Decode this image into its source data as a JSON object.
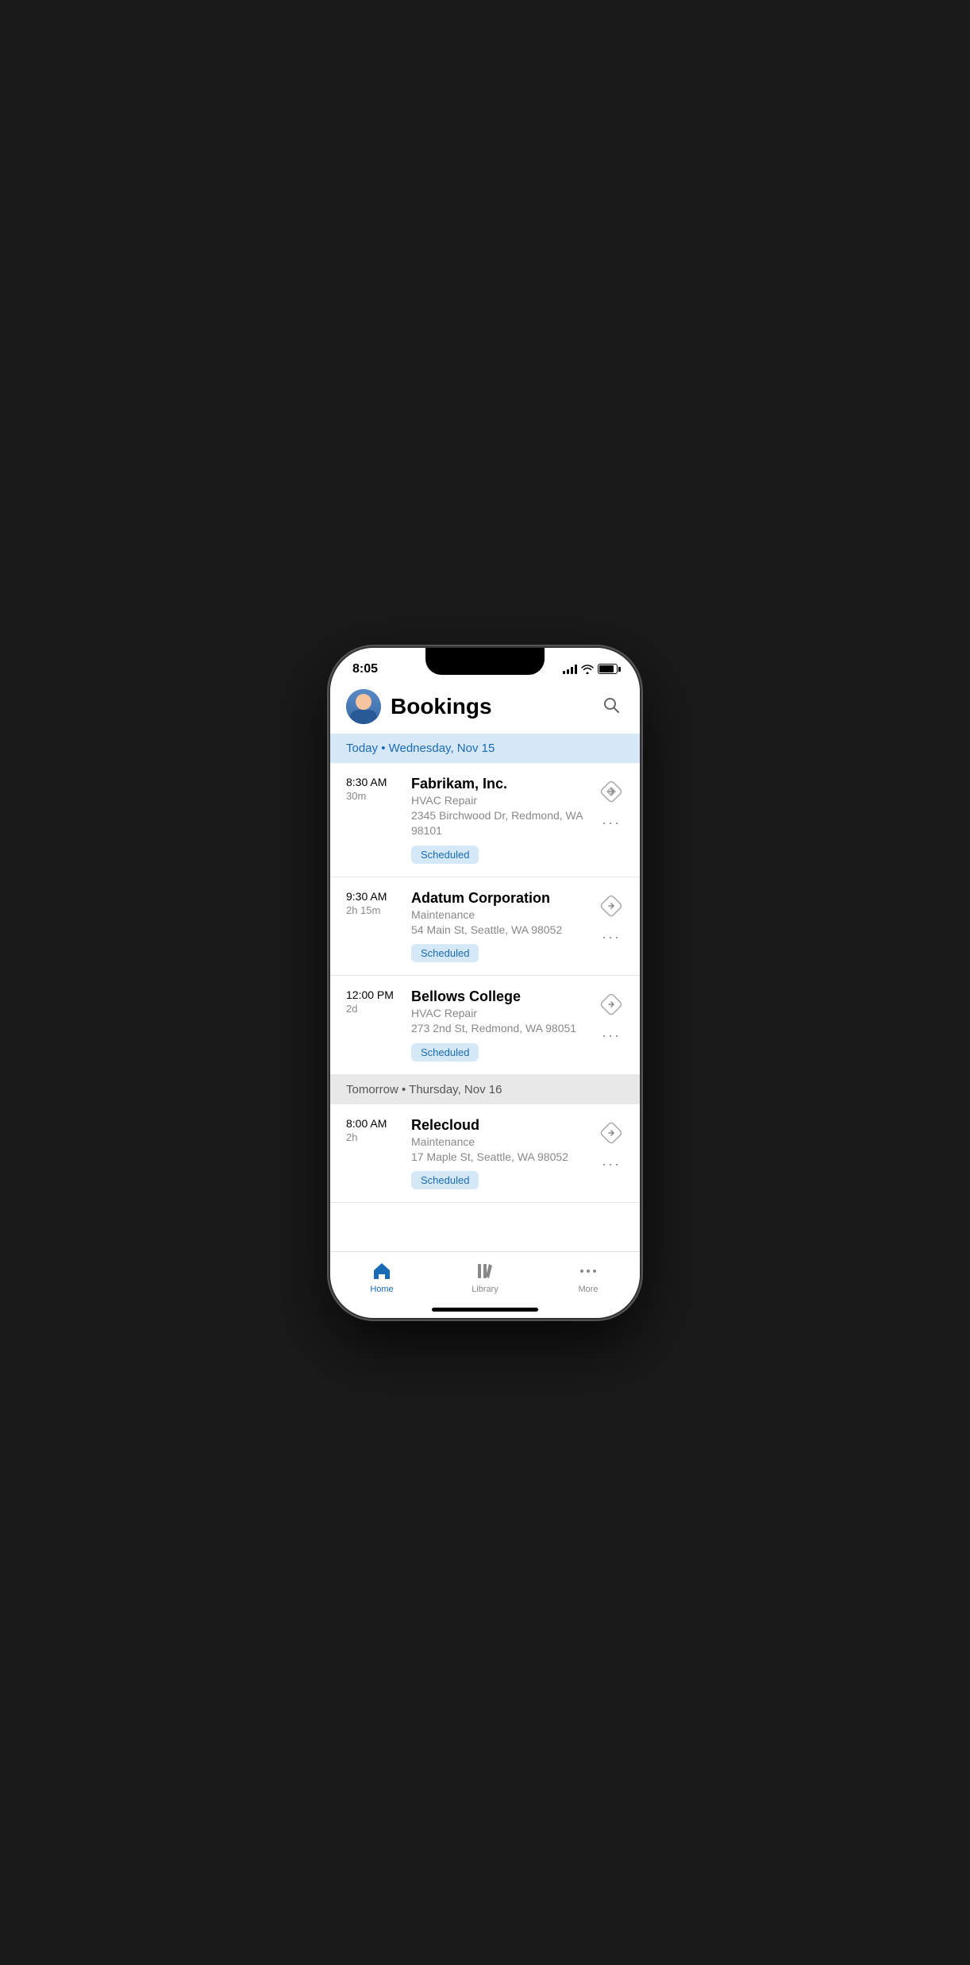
{
  "statusBar": {
    "time": "8:05"
  },
  "header": {
    "title": "Bookings",
    "searchLabel": "Search"
  },
  "sections": [
    {
      "id": "today",
      "label": "Today • Wednesday, Nov 15",
      "type": "today",
      "bookings": [
        {
          "id": "booking-1",
          "time": "8:30 AM",
          "duration": "30m",
          "name": "Fabrikam, Inc.",
          "service": "HVAC Repair",
          "address": "2345 Birchwood Dr, Redmond, WA 98101",
          "status": "Scheduled"
        },
        {
          "id": "booking-2",
          "time": "9:30 AM",
          "duration": "2h 15m",
          "name": "Adatum Corporation",
          "service": "Maintenance",
          "address": "54 Main St, Seattle, WA 98052",
          "status": "Scheduled"
        },
        {
          "id": "booking-3",
          "time": "12:00 PM",
          "duration": "2d",
          "name": "Bellows College",
          "service": "HVAC Repair",
          "address": "273 2nd St, Redmond, WA 98051",
          "status": "Scheduled"
        }
      ]
    },
    {
      "id": "tomorrow",
      "label": "Tomorrow • Thursday, Nov 16",
      "type": "tomorrow",
      "bookings": [
        {
          "id": "booking-4",
          "time": "8:00 AM",
          "duration": "2h",
          "name": "Relecloud",
          "service": "Maintenance",
          "address": "17 Maple St, Seattle, WA 98052",
          "status": "Scheduled"
        }
      ]
    }
  ],
  "tabBar": {
    "tabs": [
      {
        "id": "home",
        "label": "Home",
        "active": true
      },
      {
        "id": "library",
        "label": "Library",
        "active": false
      },
      {
        "id": "more",
        "label": "More",
        "active": false
      }
    ]
  }
}
